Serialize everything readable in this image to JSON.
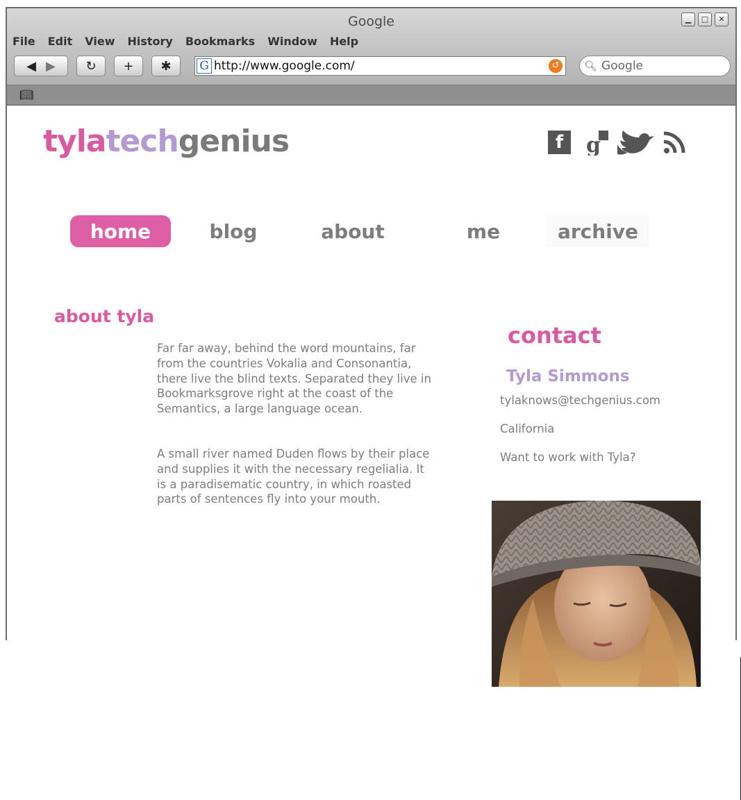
{
  "browser": {
    "title": "Google",
    "menu": [
      "File",
      "Edit",
      "View",
      "History",
      "Bookmarks",
      "Window",
      "Help"
    ],
    "url": "http://www.google.com/",
    "search_placeholder": "Google",
    "favicon_letter": "G"
  },
  "site": {
    "logo": {
      "part1": "tyla",
      "part2": "tech",
      "part3": "genius"
    },
    "social_icons": [
      "facebook-icon",
      "google-plus-icon",
      "twitter-icon",
      "rss-icon"
    ],
    "nav": [
      {
        "label": "home",
        "active": true
      },
      {
        "label": "blog",
        "active": false
      },
      {
        "label": "about",
        "active": false
      },
      {
        "label": "me",
        "active": false
      },
      {
        "label": "archive",
        "active": false
      }
    ],
    "about": {
      "heading": "about tyla",
      "paragraph1": "Far far away, behind the word mountains, far from the countries Vokalia and Consonantia, there live the blind texts. Separated they live in Bookmarksgrove right at the coast of the Semantics, a large language ocean.",
      "paragraph2": "A small river named Duden flows by their place and supplies it with the necessary regelialia. It is a paradisematic country, in which roasted parts of sentences fly into your mouth."
    },
    "contact": {
      "heading": "contact",
      "name": "Tyla Simmons",
      "email": "tylaknows@techgenius.com",
      "location": "California",
      "cta": "Want to work with Tyla?"
    },
    "colors": {
      "pink": "#d95aa0",
      "lavender": "#b39ad0",
      "gray": "#7a7a7a",
      "nav_active_bg": "#df5fa6"
    }
  }
}
